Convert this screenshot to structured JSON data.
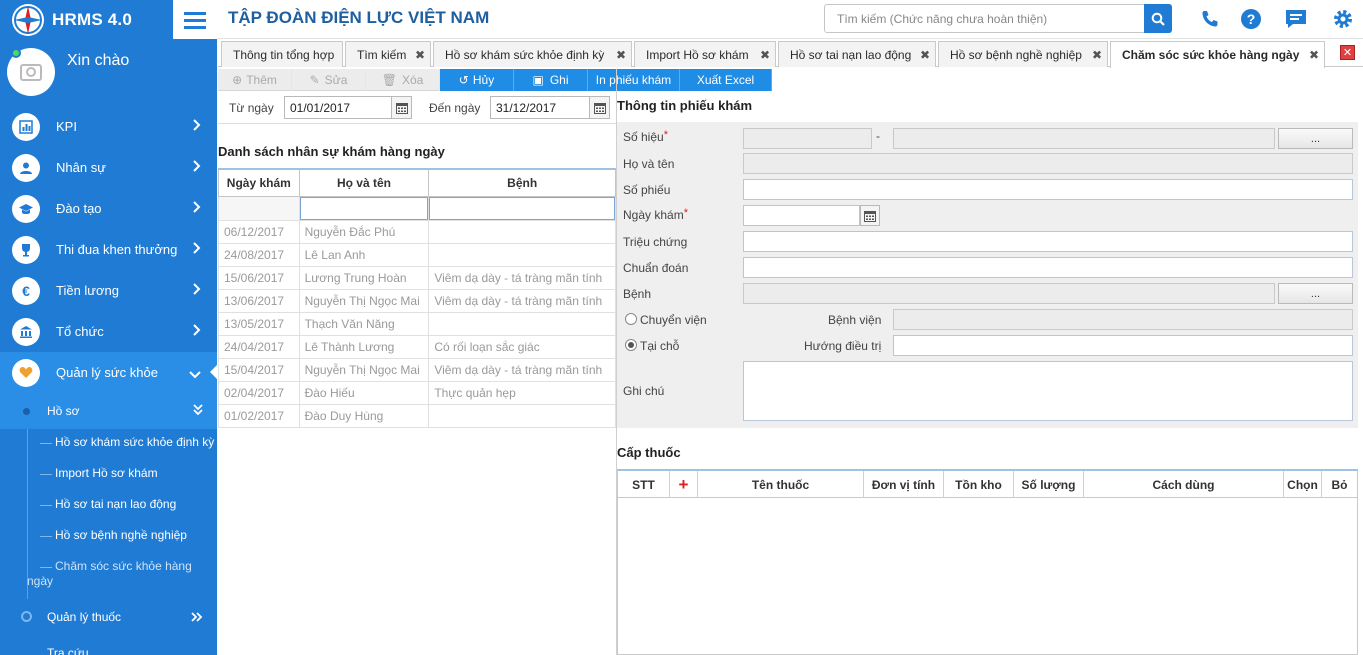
{
  "app": {
    "title": "HRMS 4.0",
    "company": "TẬP ĐOÀN ĐIỆN LỰC VIỆT NAM",
    "search_placeholder": "Tìm kiếm (Chức năng chưa hoàn thiện)",
    "accent": "#1f7bd3"
  },
  "profile": {
    "greeting": "Xin chào"
  },
  "menu": [
    {
      "label": "KPI",
      "icon": "chart-icon"
    },
    {
      "label": "Nhân sự",
      "icon": "user-icon"
    },
    {
      "label": "Đào tạo",
      "icon": "graduation-cap-icon"
    },
    {
      "label": "Thi đua khen thưởng",
      "icon": "trophy-icon"
    },
    {
      "label": "Tiền lương",
      "icon": "euro-icon"
    },
    {
      "label": "Tổ chức",
      "icon": "bank-icon"
    },
    {
      "label": "Quản lý sức khỏe",
      "icon": "heart-icon"
    }
  ],
  "submenu": {
    "ho_so": "Hồ sơ",
    "leaves": [
      "Hồ sơ khám sức khỏe định kỳ",
      "Import Hồ sơ khám",
      "Hồ sơ tai nạn lao động",
      "Hồ sơ bệnh nghề nghiệp",
      "Chăm sóc sức khỏe hàng",
      "ngày"
    ],
    "quan_ly_thuoc": "Quản lý thuốc",
    "cut_item": "Tra cứu"
  },
  "tabs": [
    "Thông tin tổng hợp",
    "Tìm kiếm",
    "Hồ sơ khám sức khỏe định kỳ",
    "Import Hồ sơ khám",
    "Hồ sơ tai nạn lao động",
    "Hồ sơ bệnh nghề nghiệp",
    "Chăm sóc sức khỏe hàng ngày"
  ],
  "toolbar": {
    "them": "Thêm",
    "sua": "Sửa",
    "xoa": "Xóa",
    "huy": "Hủy",
    "ghi": "Ghi",
    "in": "In phiếu khám",
    "excel": "Xuất Excel"
  },
  "filter": {
    "from_label": "Từ ngày",
    "from_value": "01/01/2017",
    "to_label": "Đến ngày",
    "to_value": "31/12/2017"
  },
  "list": {
    "title": "Danh sách nhân sự khám hàng ngày",
    "headers": [
      "Ngày khám",
      "Họ và tên",
      "Bệnh"
    ],
    "rows": [
      [
        "06/12/2017",
        "Nguyễn Đắc Phú",
        ""
      ],
      [
        "24/08/2017",
        "Lê Lan Anh",
        ""
      ],
      [
        "15/06/2017",
        "Lương Trung Hoàn",
        "Viêm dạ dày - tá tràng mãn tính"
      ],
      [
        "13/06/2017",
        "Nguyễn Thị Ngọc Mai",
        "Viêm dạ dày - tá tràng mãn tính"
      ],
      [
        "13/05/2017",
        "Thạch Văn Năng",
        ""
      ],
      [
        "24/04/2017",
        "Lê Thành Lương",
        "Có rối loạn sắc giác"
      ],
      [
        "15/04/2017",
        "Nguyễn Thị Ngọc Mai",
        "Viêm dạ dày - tá tràng mãn tính"
      ],
      [
        "02/04/2017",
        "Đào Hiếu",
        "Thực quản hẹp"
      ],
      [
        "01/02/2017",
        "Đào Duy Hùng",
        ""
      ]
    ]
  },
  "form": {
    "title": "Thông tin phiếu khám",
    "so_hieu": "Số hiệu",
    "dash": "-",
    "dots": "...",
    "ho_ten": "Họ và tên",
    "so_phieu": "Số phiếu",
    "ngay_kham": "Ngày khám",
    "trieu_chung": "Triệu chứng",
    "chuan_doan": "Chuẩn đoán",
    "benh": "Bệnh",
    "chuyen_vien": "Chuyển viện",
    "benh_vien": "Bệnh viện",
    "tai_cho": "Tại chỗ",
    "huong_dieu_tri": "Hướng điều trị",
    "ghi_chu": "Ghi chú",
    "required_mark": "*",
    "selected_option": "Tại chỗ"
  },
  "meds": {
    "title": "Cấp thuốc",
    "add": "+",
    "headers": [
      "STT",
      "Tên thuốc",
      "Đơn vị tính",
      "Tồn kho",
      "Số lượng",
      "Cách dùng",
      "Chọn",
      "Bỏ"
    ]
  }
}
